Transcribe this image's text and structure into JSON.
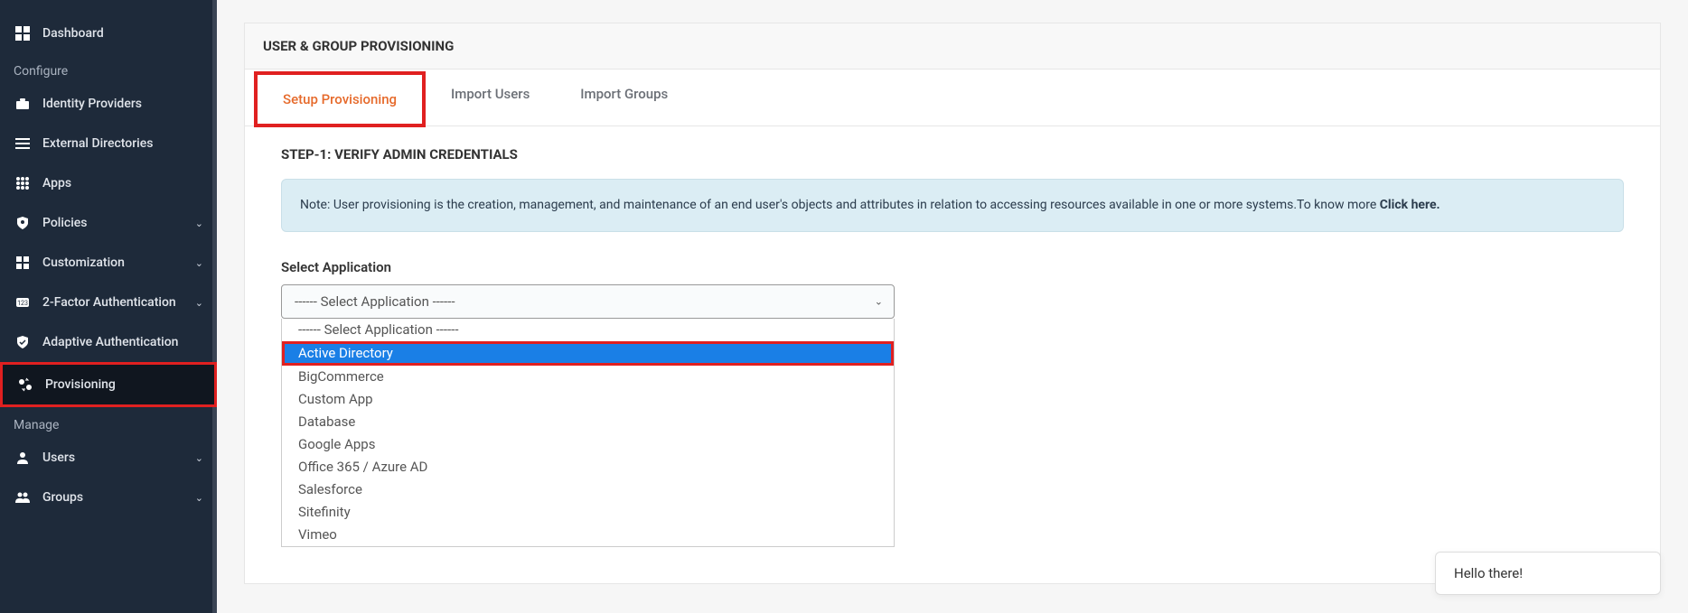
{
  "sidebar": {
    "items": [
      {
        "label": "Dashboard"
      }
    ],
    "section_configure": "Configure",
    "configure_items": [
      {
        "label": "Identity Providers",
        "chevron": false
      },
      {
        "label": "External Directories",
        "chevron": false
      },
      {
        "label": "Apps",
        "chevron": false
      },
      {
        "label": "Policies",
        "chevron": true
      },
      {
        "label": "Customization",
        "chevron": true
      },
      {
        "label": "2-Factor Authentication",
        "chevron": true
      },
      {
        "label": "Adaptive Authentication",
        "chevron": false
      },
      {
        "label": "Provisioning",
        "chevron": false
      }
    ],
    "section_manage": "Manage",
    "manage_items": [
      {
        "label": "Users",
        "chevron": true
      },
      {
        "label": "Groups",
        "chevron": true
      }
    ]
  },
  "panel": {
    "title": "USER & GROUP PROVISIONING",
    "tabs": [
      {
        "label": "Setup Provisioning"
      },
      {
        "label": "Import Users"
      },
      {
        "label": "Import Groups"
      }
    ],
    "step_title": "STEP-1: VERIFY ADMIN CREDENTIALS",
    "info_text": "Note: User provisioning is the creation, management, and maintenance of an end user's objects and attributes in relation to accessing resources available in one or more systems.To know more ",
    "info_link": "Click here.",
    "select_label": "Select Application",
    "select_value": "------ Select Application ------",
    "options": [
      "------ Select Application ------",
      "Active Directory",
      "BigCommerce",
      "Custom App",
      "Database",
      "Google Apps",
      "Office 365 / Azure AD",
      "Salesforce",
      "Sitefinity",
      "Vimeo"
    ]
  },
  "chat": {
    "text": "Hello there!"
  }
}
